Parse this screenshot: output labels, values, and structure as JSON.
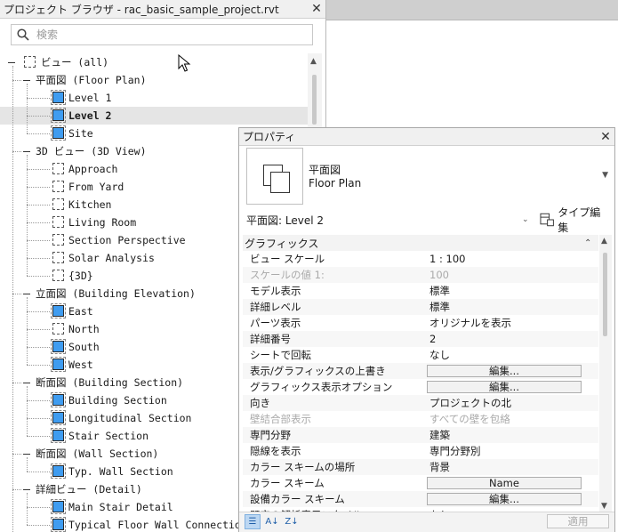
{
  "project_browser": {
    "title": "プロジェクト ブラウザ - rac_basic_sample_project.rvt",
    "search_placeholder": "検索",
    "tree": [
      {
        "label": "ビュー (all)",
        "level": 0,
        "icon": "views-root"
      },
      {
        "label": "平面図 (Floor Plan)",
        "level": 1,
        "icon": "none"
      },
      {
        "label": "Level 1",
        "level": 2,
        "icon": "view-plan"
      },
      {
        "label": "Level 2",
        "level": 2,
        "icon": "view-plan",
        "selected": true
      },
      {
        "label": "Site",
        "level": 2,
        "icon": "view-plan"
      },
      {
        "label": "3D ビュー (3D View)",
        "level": 1,
        "icon": "none"
      },
      {
        "label": "Approach",
        "level": 2,
        "icon": "view-3d"
      },
      {
        "label": "From Yard",
        "level": 2,
        "icon": "view-3d"
      },
      {
        "label": "Kitchen",
        "level": 2,
        "icon": "view-3d"
      },
      {
        "label": "Living Room",
        "level": 2,
        "icon": "view-3d"
      },
      {
        "label": "Section Perspective",
        "level": 2,
        "icon": "view-3d"
      },
      {
        "label": "Solar Analysis",
        "level": 2,
        "icon": "view-3d"
      },
      {
        "label": "{3D}",
        "level": 2,
        "icon": "view-3d"
      },
      {
        "label": "立面図 (Building Elevation)",
        "level": 1,
        "icon": "none"
      },
      {
        "label": "East",
        "level": 2,
        "icon": "view-plan"
      },
      {
        "label": "North",
        "level": 2,
        "icon": "view-3d"
      },
      {
        "label": "South",
        "level": 2,
        "icon": "view-plan"
      },
      {
        "label": "West",
        "level": 2,
        "icon": "view-plan"
      },
      {
        "label": "断面図 (Building Section)",
        "level": 1,
        "icon": "none"
      },
      {
        "label": "Building Section",
        "level": 2,
        "icon": "view-plan"
      },
      {
        "label": "Longitudinal Section",
        "level": 2,
        "icon": "view-plan"
      },
      {
        "label": "Stair Section",
        "level": 2,
        "icon": "view-plan"
      },
      {
        "label": "断面図 (Wall Section)",
        "level": 1,
        "icon": "none"
      },
      {
        "label": "Typ. Wall Section",
        "level": 2,
        "icon": "view-plan"
      },
      {
        "label": "詳細ビュー (Detail)",
        "level": 1,
        "icon": "none"
      },
      {
        "label": "Main Stair Detail",
        "level": 2,
        "icon": "view-plan"
      },
      {
        "label": "Typical Floor Wall Connection",
        "level": 2,
        "icon": "view-plan"
      }
    ]
  },
  "properties": {
    "title": "プロパティ",
    "type_name_jp": "平面図",
    "type_name_en": "Floor Plan",
    "instance_selector": "平面図: Level 2",
    "edit_type_label": "タイプ編集",
    "category": "グラフィックス",
    "rows": [
      {
        "key": "ビュー スケール",
        "value": "1 : 100"
      },
      {
        "key": "スケールの値   1:",
        "value": "100",
        "disabled": true
      },
      {
        "key": "モデル表示",
        "value": "標準"
      },
      {
        "key": "詳細レベル",
        "value": "標準"
      },
      {
        "key": "パーツ表示",
        "value": "オリジナルを表示"
      },
      {
        "key": "詳細番号",
        "value": "2"
      },
      {
        "key": "シートで回転",
        "value": "なし"
      },
      {
        "key": "表示/グラフィックスの上書き",
        "value": "編集...",
        "button": true
      },
      {
        "key": "グラフィックス表示オプション",
        "value": "編集...",
        "button": true
      },
      {
        "key": "向き",
        "value": "プロジェクトの北"
      },
      {
        "key": "壁結合部表示",
        "value": "すべての壁を包絡",
        "disabled": true
      },
      {
        "key": "専門分野",
        "value": "建築"
      },
      {
        "key": "隠線を表示",
        "value": "専門分野別"
      },
      {
        "key": "カラー スキームの場所",
        "value": "背景"
      },
      {
        "key": "カラー スキーム",
        "value": "Name",
        "button": true
      },
      {
        "key": "設備カラー スキーム",
        "value": "編集...",
        "button": true
      },
      {
        "key": "既定の解析表示スタイル",
        "value": "なし"
      }
    ],
    "apply_label": "適用"
  }
}
